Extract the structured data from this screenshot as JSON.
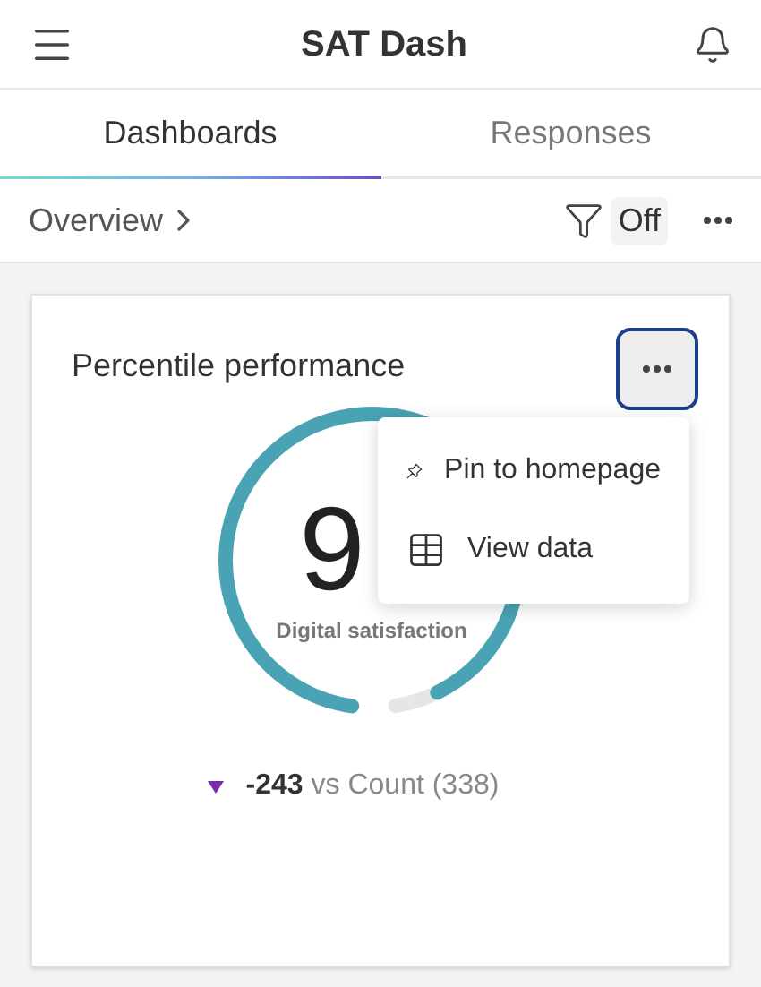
{
  "header": {
    "title": "SAT Dash"
  },
  "tabs": [
    {
      "label": "Dashboards",
      "selected": true
    },
    {
      "label": "Responses",
      "selected": false
    }
  ],
  "breadcrumb": {
    "label": "Overview",
    "filter": "Off"
  },
  "card": {
    "title": "Percentile performance",
    "menu_open": true,
    "menu": [
      {
        "kind": "pin",
        "label": "Pin to homepage"
      },
      {
        "kind": "table",
        "label": "View data"
      }
    ],
    "gauge": {
      "level": 0.95,
      "value": "9",
      "label": "Digital satisfaction"
    },
    "comparison": {
      "delta": "-243",
      "text": "vs Count (338)"
    }
  }
}
